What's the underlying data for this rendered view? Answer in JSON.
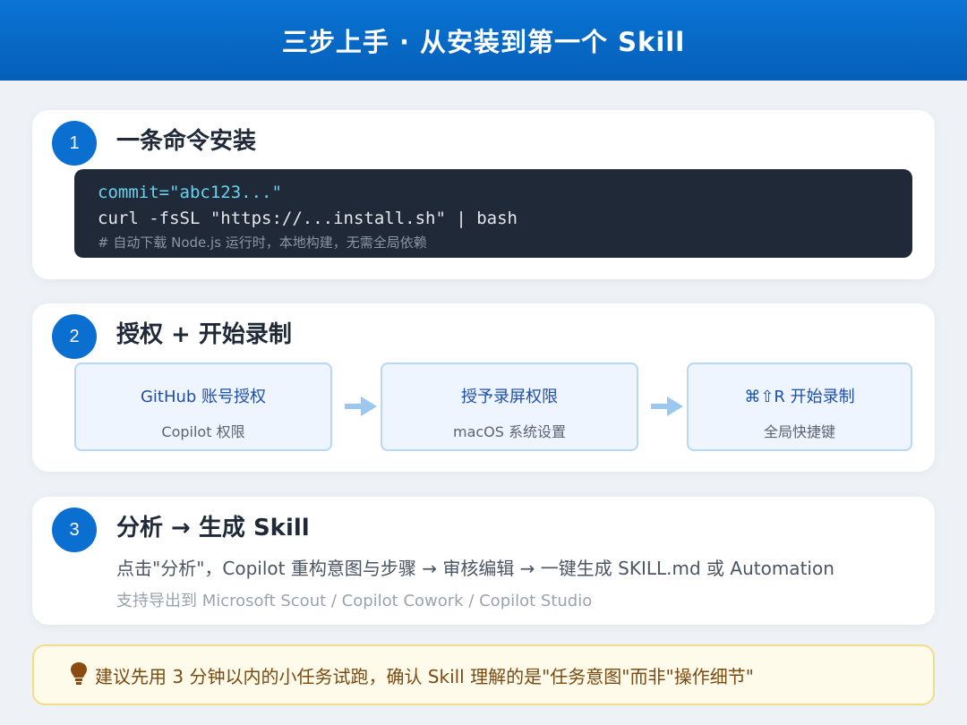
{
  "header": {
    "title": "三步上手 · 从安装到第一个 Skill"
  },
  "colors": {
    "primary": "#0b6fd1",
    "code_bg": "#1f2937",
    "tip_bg": "#fffbea",
    "tip_border": "#f4dc8a"
  },
  "steps": [
    {
      "number": "1",
      "title": "一条命令安装",
      "code": {
        "line1": "commit=\"abc123...\"",
        "line2": "curl -fsSL \"https://...install.sh\" | bash",
        "comment": "# 自动下载 Node.js 运行时，本地构建，无需全局依赖"
      }
    },
    {
      "number": "2",
      "title": "授权 + 开始录制",
      "boxes": [
        {
          "title": "GitHub 账号授权",
          "subtitle": "Copilot 权限"
        },
        {
          "title": "授予录屏权限",
          "subtitle": "macOS 系统设置"
        },
        {
          "title": "⌘⇧R 开始录制",
          "subtitle": "全局快捷键"
        }
      ],
      "arrow_icon": "right-arrow-icon"
    },
    {
      "number": "3",
      "title": "分析 → 生成 Skill",
      "description": "点击\"分析\"，Copilot 重构意图与步骤 → 审核编辑 → 一键生成 SKILL.md 或 Automation",
      "export_note": "支持导出到 Microsoft Scout / Copilot Cowork / Copilot Studio"
    }
  ],
  "tip": {
    "icon": "lightbulb-icon",
    "text": "建议先用 3 分钟以内的小任务试跑，确认 Skill 理解的是\"任务意图\"而非\"操作细节\""
  }
}
